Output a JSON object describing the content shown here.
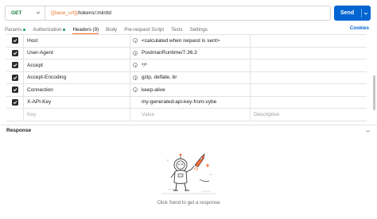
{
  "request": {
    "method": "GET",
    "url_variable": "{{base_url}}",
    "url_path": "/tokens/:mintId",
    "send_label": "Send"
  },
  "tabs": [
    {
      "label": "Params",
      "dot": true
    },
    {
      "label": "Authorization",
      "dot": true
    },
    {
      "label": "Headers (9)",
      "active": true
    },
    {
      "label": "Body"
    },
    {
      "label": "Pre-request Script"
    },
    {
      "label": "Tests"
    },
    {
      "label": "Settings"
    }
  ],
  "cookies_label": "Cookies",
  "headers": [
    {
      "key": "Host",
      "value": "<calculated when request is sent>",
      "checked": true
    },
    {
      "key": "User-Agent",
      "value": "PostmanRuntime/7.36.3",
      "checked": true
    },
    {
      "key": "Accept",
      "value": "*/*",
      "checked": true
    },
    {
      "key": "Accept-Encoding",
      "value": "gzip, deflate, br",
      "checked": true
    },
    {
      "key": "Connection",
      "value": "keep-alive",
      "checked": true
    },
    {
      "key": "X-API-Key",
      "value": "my-generated-api-key-from-vybe",
      "checked": true
    }
  ],
  "placeholder_row": {
    "key": "Key",
    "value": "Value",
    "description": "Description"
  },
  "response": {
    "label": "Response",
    "hint": "Click Send to get a response"
  },
  "colors": {
    "accent": "#ff6c37",
    "send": "#0265d2",
    "method": "#0d7c3a",
    "variable": "#e8772e"
  }
}
